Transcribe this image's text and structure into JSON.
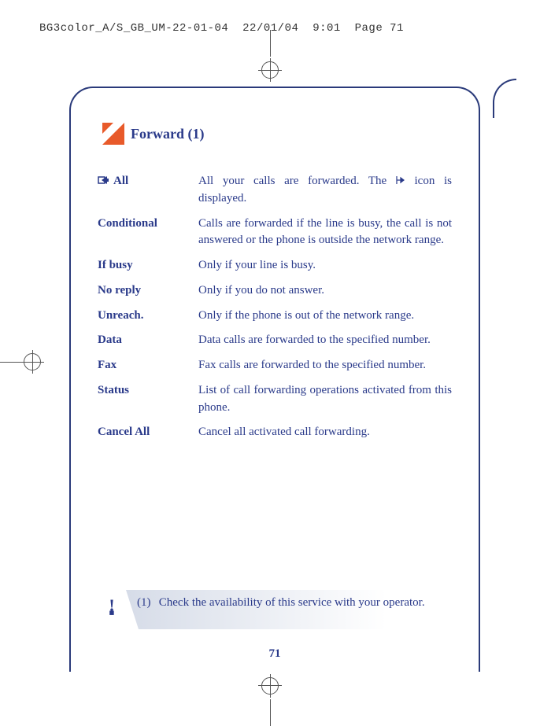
{
  "header": {
    "file": "BG3color_A/S_GB_UM-22-01-04",
    "date": "22/01/04",
    "time": "9:01",
    "page_label": "Page 71"
  },
  "heading": {
    "title": "Forward",
    "footref": "(1)"
  },
  "definitions": [
    {
      "term": "All",
      "has_icon": true,
      "desc_pre": "All your calls are forwarded. The ",
      "desc_post": " icon is displayed."
    },
    {
      "term": "Conditional",
      "has_icon": false,
      "desc": "Calls are forwarded if the line is busy, the call is not answered or the phone is outside the network range."
    },
    {
      "term": "If busy",
      "has_icon": false,
      "desc": "Only if your line is busy."
    },
    {
      "term": "No reply",
      "has_icon": false,
      "desc": "Only if you do not answer."
    },
    {
      "term": "Unreach.",
      "has_icon": false,
      "desc": "Only if the phone is out of the network range."
    },
    {
      "term": "Data",
      "has_icon": false,
      "desc": "Data calls are forwarded to the specified number."
    },
    {
      "term": "Fax",
      "has_icon": false,
      "desc": "Fax calls are forwarded to the specified number."
    },
    {
      "term": "Status",
      "has_icon": false,
      "desc": "List of call forwarding operations activated from this phone."
    },
    {
      "term": "Cancel All",
      "has_icon": false,
      "desc": "Cancel all activated call forwarding."
    }
  ],
  "footnote": {
    "label": "(1)",
    "text": "Check the availability of this service with your operator."
  },
  "page_number": "71"
}
